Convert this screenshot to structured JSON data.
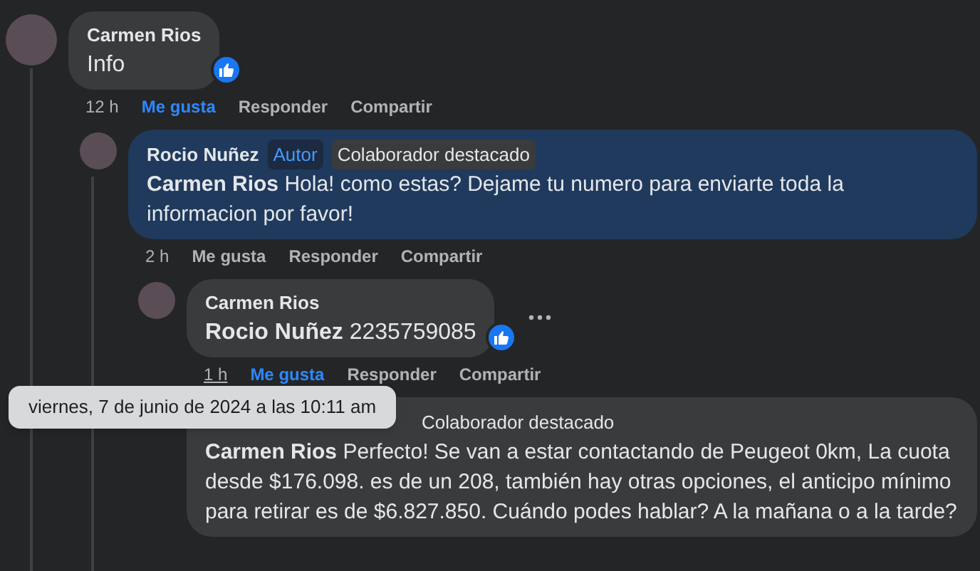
{
  "comments": [
    {
      "author": "Carmen Rios",
      "text": "Info",
      "highlighted": false,
      "liked": true,
      "show_more": false,
      "time": "12 h",
      "time_underlined": false,
      "actions": [
        {
          "label": "Me gusta",
          "selected": true
        },
        {
          "label": "Responder",
          "selected": false
        },
        {
          "label": "Compartir",
          "selected": false
        }
      ],
      "children": [
        {
          "author": "Rocio Nuñez",
          "badges": [
            {
              "label": "Autor",
              "kind": "author"
            },
            {
              "label": "Colaborador destacado",
              "kind": "contributor"
            }
          ],
          "mention": "Carmen Rios",
          "text": "Hola! como estas? Dejame tu numero para enviarte toda la informacion por favor!",
          "highlighted": true,
          "liked": false,
          "show_more": false,
          "time": "2 h",
          "time_underlined": false,
          "actions": [
            {
              "label": "Me gusta",
              "selected": false
            },
            {
              "label": "Responder",
              "selected": false
            },
            {
              "label": "Compartir",
              "selected": false
            }
          ],
          "children": [
            {
              "author": "Carmen Rios",
              "mention": "Rocio Nuñez",
              "text": "2235759085",
              "highlighted": false,
              "liked": true,
              "show_more": true,
              "time": "1 h",
              "time_underlined": true,
              "actions": [
                {
                  "label": "Me gusta",
                  "selected": true
                },
                {
                  "label": "Responder",
                  "selected": false
                },
                {
                  "label": "Compartir",
                  "selected": false
                }
              ]
            },
            {
              "badges": [
                {
                  "label": "Colaborador destacado",
                  "kind": "contributor"
                }
              ],
              "mention": "Carmen Rios",
              "text": "Perfecto! Se van a estar contactando de Peugeot 0km, La cuota desde $176.098. es de un 208, también hay otras opciones, el anticipo mínimo para retirar es de $6.827.850. Cuándo podes hablar? A la mañana o a la tarde?",
              "highlighted": false,
              "liked": false,
              "show_more": false
            }
          ]
        }
      ]
    }
  ],
  "tooltip": {
    "text": "viernes, 7 de junio de 2024 a las 10:11 am"
  }
}
